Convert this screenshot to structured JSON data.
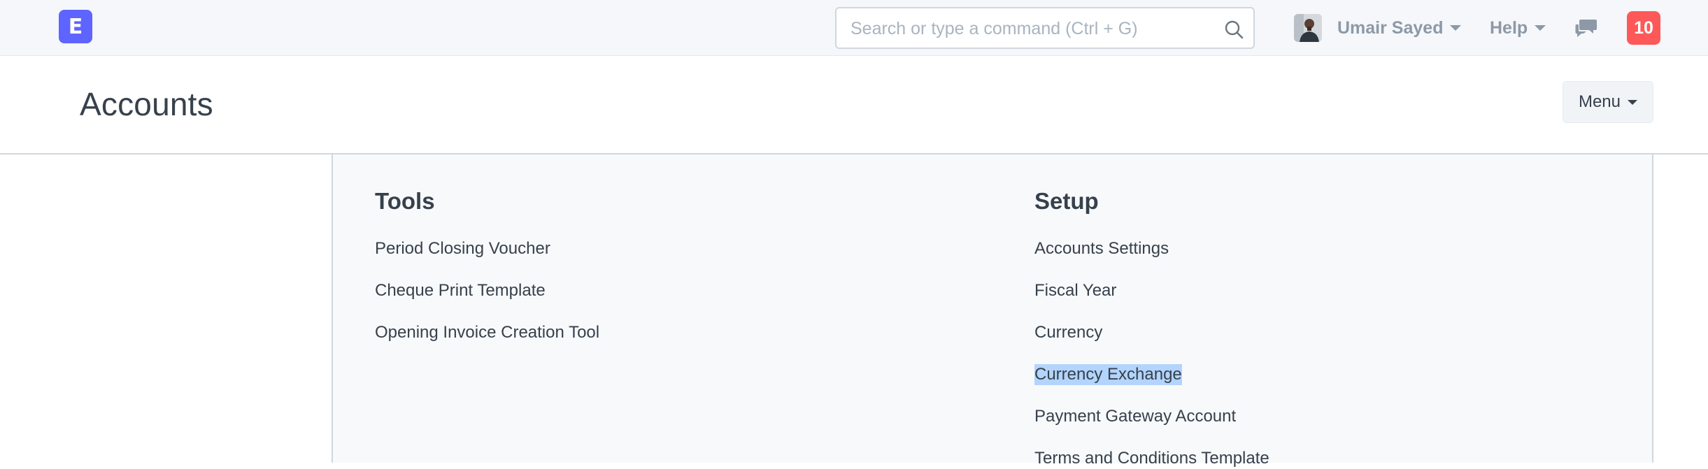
{
  "navbar": {
    "logo_letter": "E",
    "search_placeholder": "Search or type a command (Ctrl + G)",
    "user_name": "Umair Sayed",
    "help_label": "Help",
    "notification_count": "10"
  },
  "page": {
    "title": "Accounts",
    "menu_label": "Menu"
  },
  "sections": {
    "tools": {
      "title": "Tools",
      "items": [
        "Period Closing Voucher",
        "Cheque Print Template",
        "Opening Invoice Creation Tool"
      ]
    },
    "setup": {
      "title": "Setup",
      "items": [
        "Accounts Settings",
        "Fiscal Year",
        "Currency",
        "Currency Exchange",
        "Payment Gateway Account",
        "Terms and Conditions Template"
      ],
      "selected_item": "Currency Exchange"
    }
  },
  "colors": {
    "brand": "#5e64ff",
    "badge": "#ff5858",
    "selection": "#b3d4fc"
  }
}
